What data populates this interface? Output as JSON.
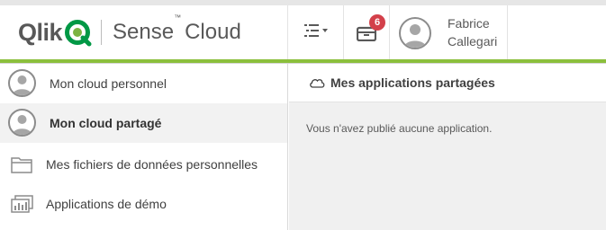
{
  "header": {
    "logo_text": "Qlik",
    "product_name": "Sense",
    "product_suffix": "Cloud",
    "trademark": "™",
    "list_menu_icon": "list-menu-icon",
    "notifications_icon": "inbox-icon",
    "notifications_count": "6",
    "user": {
      "first_name": "Fabrice",
      "last_name": "Callegari",
      "avatar_icon": "user-avatar-icon"
    },
    "accent_color": "#8bbf3c",
    "badge_color": "#d3404a"
  },
  "sidebar": {
    "items": [
      {
        "label": "Mon cloud personnel",
        "icon": "user-avatar-icon",
        "active": false
      },
      {
        "label": "Mon cloud partagé",
        "icon": "user-avatar-icon",
        "active": true
      },
      {
        "label": "Mes fichiers de données personnelles",
        "icon": "folder-icon",
        "active": false
      },
      {
        "label": "Applications de démo",
        "icon": "demo-apps-icon",
        "active": false
      }
    ]
  },
  "main": {
    "title": "Mes applications partagées",
    "title_icon": "cloud-icon",
    "empty_message": "Vous n'avez publié aucune application."
  }
}
